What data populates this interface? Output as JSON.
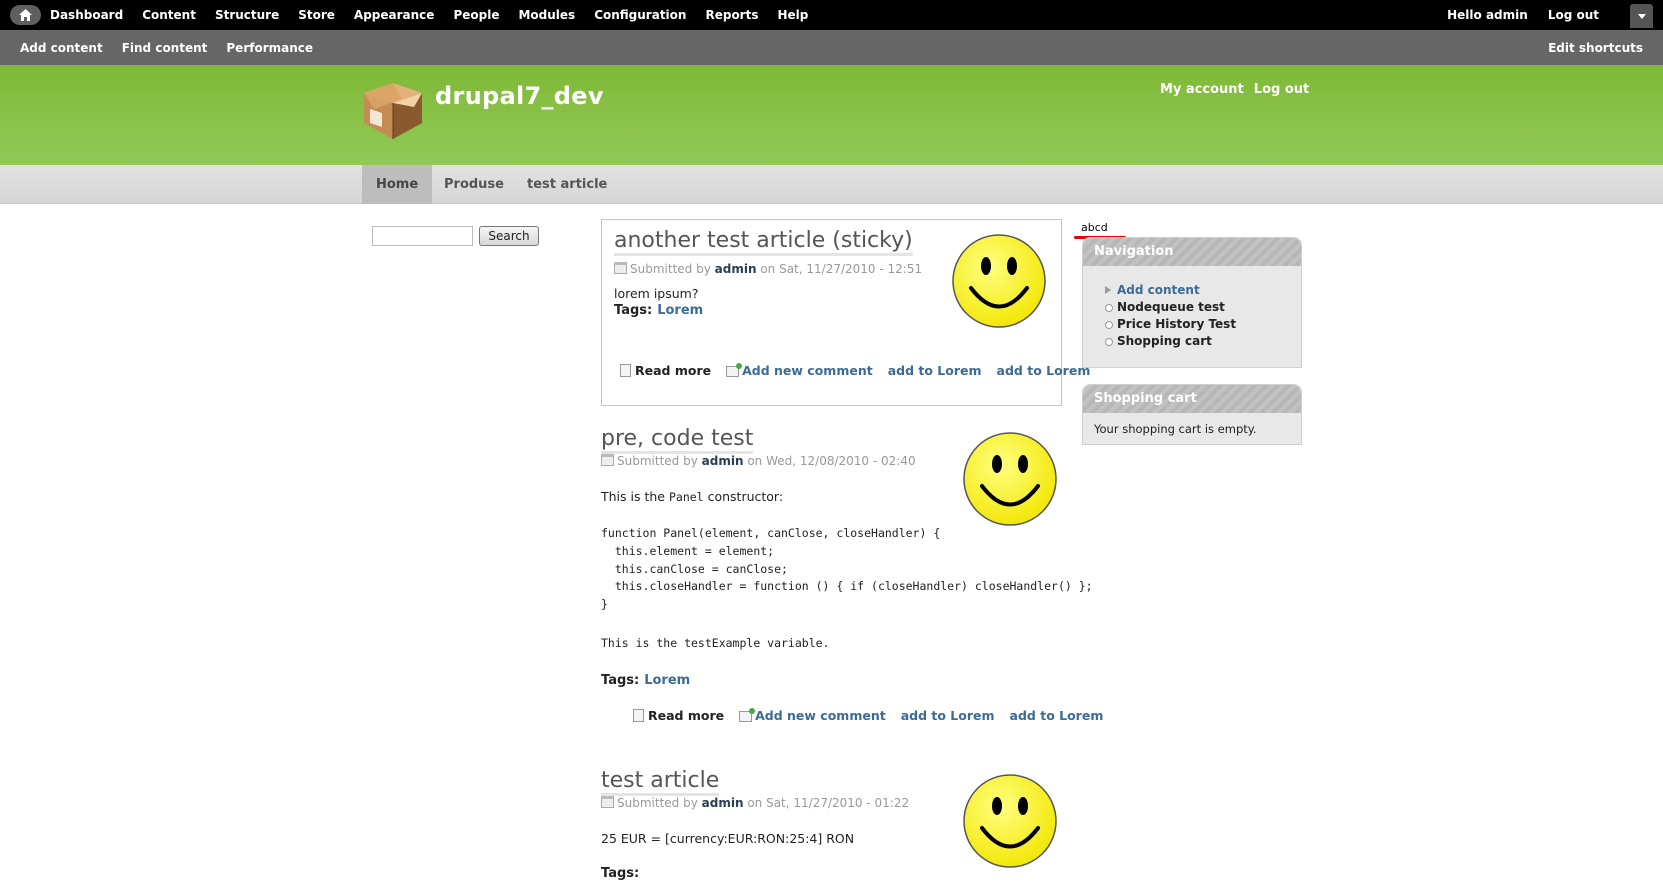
{
  "toolbar": {
    "menu": [
      "Dashboard",
      "Content",
      "Structure",
      "Store",
      "Appearance",
      "People",
      "Modules",
      "Configuration",
      "Reports",
      "Help"
    ],
    "greeting": "Hello admin",
    "logout": "Log out"
  },
  "shortcuts": {
    "items": [
      "Add content",
      "Find content",
      "Performance"
    ],
    "edit": "Edit shortcuts"
  },
  "header": {
    "site_name": "drupal7_dev",
    "secondary_menu": [
      "My account",
      "Log out"
    ]
  },
  "main_menu": [
    "Home",
    "Produse",
    "test article"
  ],
  "search": {
    "button": "Search",
    "value": ""
  },
  "articles": [
    {
      "title": "another test article (sticky)",
      "submitted_prefix": "Submitted by",
      "author": "admin",
      "date": "on Sat, 11/27/2010 - 12:51",
      "body": "lorem ipsum?",
      "tags_label": "Tags:",
      "tag": "Lorem",
      "links": [
        "Read more",
        "Add new comment",
        "add to Lorem",
        "add to Lorem"
      ]
    },
    {
      "title": "pre, code test",
      "submitted_prefix": "Submitted by",
      "author": "admin",
      "date": "on Wed, 12/08/2010 - 02:40",
      "body_before": "This is the",
      "body_code": "Panel",
      "body_after": "constructor:",
      "code": "function Panel(element, canClose, closeHandler) {\n  this.element = element;\n  this.canClose = canClose;\n  this.closeHandler = function () { if (closeHandler) closeHandler() };\n}",
      "code_note": "This is the testExample variable.",
      "tags_label": "Tags:",
      "tag": "Lorem",
      "links": [
        "Read more",
        "Add new comment",
        "add to Lorem",
        "add to Lorem"
      ]
    },
    {
      "title": "test article",
      "submitted_prefix": "Submitted by",
      "author": "admin",
      "date": "on Sat, 11/27/2010 - 01:22",
      "body": "25 EUR = [currency:EUR:RON:25:4] RON",
      "tags_label": "Tags:"
    }
  ],
  "sidebar": {
    "label": "abcd",
    "navigation_title": "Navigation",
    "navigation_items": [
      "Add content",
      "Nodequeue test",
      "Price History Test",
      "Shopping cart"
    ],
    "cart_title": "Shopping cart",
    "cart_text": "Your shopping cart is empty."
  }
}
